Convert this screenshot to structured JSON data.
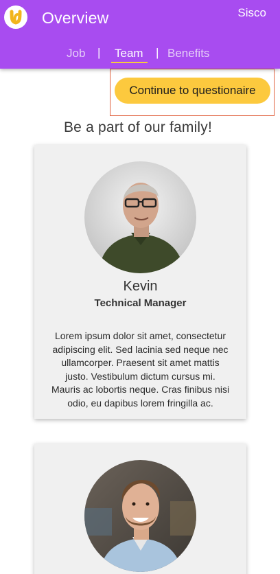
{
  "header": {
    "title": "Overview",
    "company": "Sisco",
    "logo_icon": "logo-icon",
    "background_color": "#a84cf0",
    "tabs": [
      {
        "label": "Job",
        "active": false
      },
      {
        "label": "Team",
        "active": true
      },
      {
        "label": "Benefits",
        "active": false
      }
    ],
    "separator": "|"
  },
  "cta": {
    "label": "Continue to questionaire",
    "color": "#fcc93e"
  },
  "section": {
    "title": "Be a part of our family!"
  },
  "team": [
    {
      "name": "Kevin",
      "role": "Technical Manager",
      "bio": "Lorem ipsum dolor sit amet, consectetur adipiscing elit. Sed lacinia sed neque nec ullamcorper. Praesent sit amet mattis justo. Vestibulum dictum cursus mi. Mauris ac lobortis neque. Cras finibus nisi odio, eu dapibus lorem fringilla ac.",
      "avatar_icon": "person-photo"
    },
    {
      "avatar_icon": "person-photo"
    }
  ]
}
